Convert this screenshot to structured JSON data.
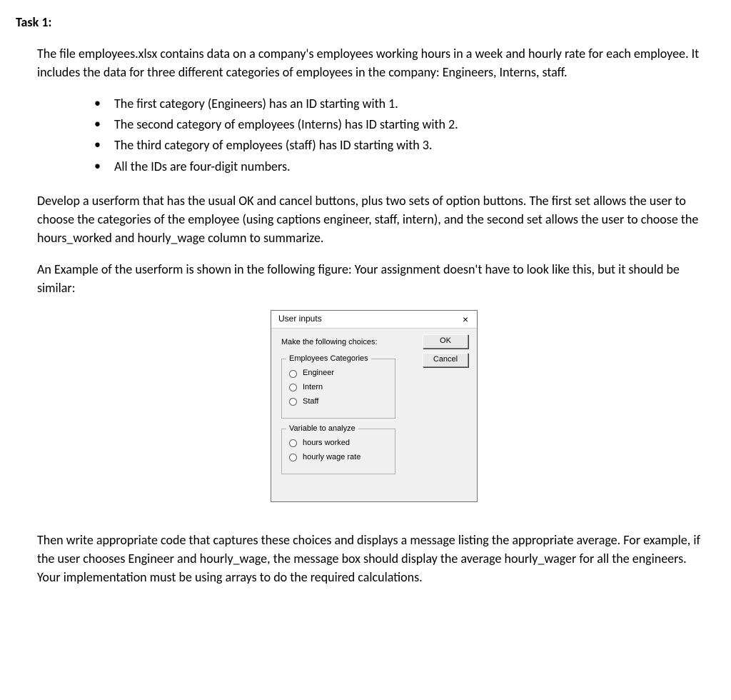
{
  "heading": "Task 1:",
  "para1": "The file employees.xlsx contains data on a company's employees working hours in a week and hourly rate for each employee. It includes the data for three different categories of employees in the company: Engineers, Interns, staff.",
  "bullets": {
    "b1": "The first category (Engineers) has an ID starting with 1.",
    "b2": "The second category of employees (Interns) has ID starting with 2.",
    "b3": "The third category of employees (staff) has ID starting with 3.",
    "b4": "All the IDs are four-digit numbers."
  },
  "para2": "Develop a userform that has the usual OK and cancel buttons, plus two sets of option buttons. The first set allows the user to choose the categories of the employee (using captions engineer, staff, intern), and the second set allows the user to choose the hours_worked and hourly_wage column to summarize.",
  "para3": "An Example of the userform is shown in the following figure: Your assignment doesn't have to look like this, but it should be similar:",
  "userform": {
    "title": "User inputs",
    "close": "×",
    "prompt": "Make the following choices:",
    "ok": "OK",
    "cancel": "Cancel",
    "group1": {
      "legend": "Employees Categories",
      "opt1": "Engineer",
      "opt2": "Intern",
      "opt3": "Staff"
    },
    "group2": {
      "legend": "Variable to analyze",
      "opt1": "hours worked",
      "opt2": "hourly wage rate"
    }
  },
  "para4": "Then write appropriate code that captures these choices and displays a message listing the appropriate average. For example, if the user chooses Engineer and hourly_wage, the message box should display the average hourly_wager for all the engineers. Your implementation must be using arrays to do the required calculations."
}
